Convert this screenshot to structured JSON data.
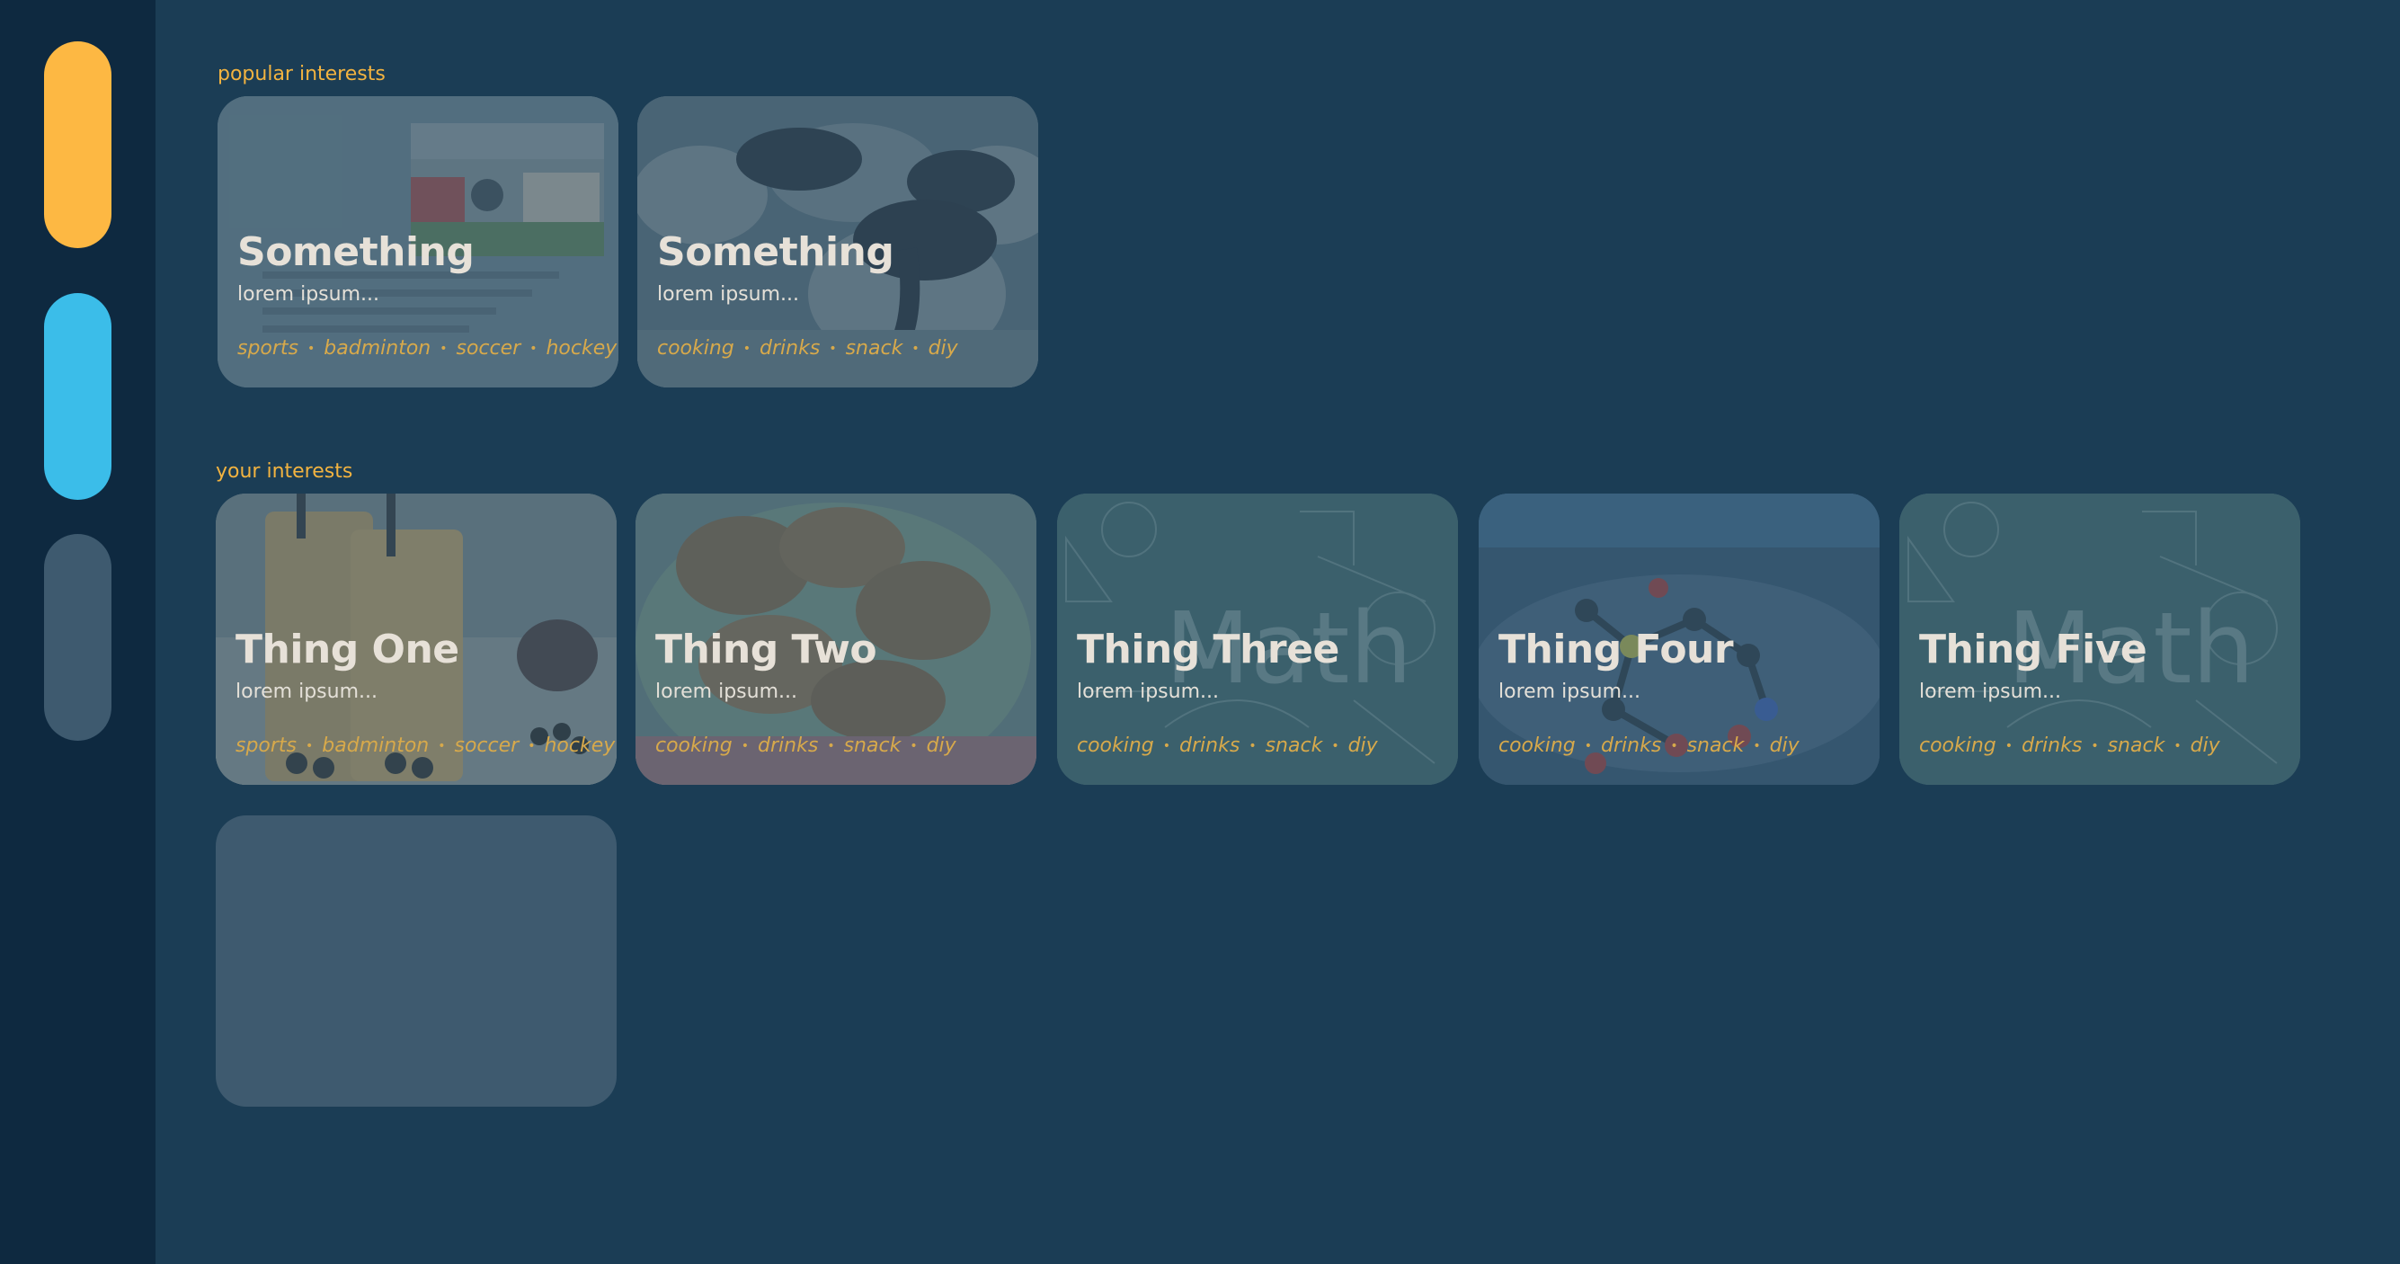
{
  "sidebar": {
    "pills": [
      {
        "color": "#fdb843"
      },
      {
        "color": "#3bbde9"
      },
      {
        "color": "#3e5a6f"
      }
    ]
  },
  "popular": {
    "label": "popular interests",
    "cards": [
      {
        "title": "Something",
        "subtitle": "lorem ipsum...",
        "tags": [
          "sports",
          "badminton",
          "soccer",
          "hockey"
        ],
        "image": "sports-photo-with-chemistry-worksheet"
      },
      {
        "title": "Something",
        "subtitle": "lorem ipsum...",
        "tags": [
          "cooking",
          "drinks",
          "snack",
          "diy"
        ],
        "image": "chocolate-cupcakes-photo"
      }
    ]
  },
  "yours": {
    "label": "your interests",
    "cards": [
      {
        "title": "Thing One",
        "subtitle": "lorem ipsum...",
        "tags": [
          "sports",
          "badminton",
          "soccer",
          "hockey"
        ],
        "image": "bubble-tea-photo"
      },
      {
        "title": "Thing Two",
        "subtitle": "lorem ipsum...",
        "tags": [
          "cooking",
          "drinks",
          "snack",
          "diy"
        ],
        "image": "fried-chicken-photo"
      },
      {
        "title": "Thing Three",
        "subtitle": "lorem ipsum...",
        "tags": [
          "cooking",
          "drinks",
          "snack",
          "diy"
        ],
        "image": "math-chalkboard"
      },
      {
        "title": "Thing Four",
        "subtitle": "lorem ipsum...",
        "tags": [
          "cooking",
          "drinks",
          "snack",
          "diy"
        ],
        "image": "molecule-model-photo"
      },
      {
        "title": "Thing Five",
        "subtitle": "lorem ipsum...",
        "tags": [
          "cooking",
          "drinks",
          "snack",
          "diy"
        ],
        "image": "math-chalkboard"
      }
    ]
  },
  "colors": {
    "background": "#1b3d55",
    "sidebar": "#0e2940",
    "accent": "#f2b340",
    "card": "#4a6576"
  }
}
